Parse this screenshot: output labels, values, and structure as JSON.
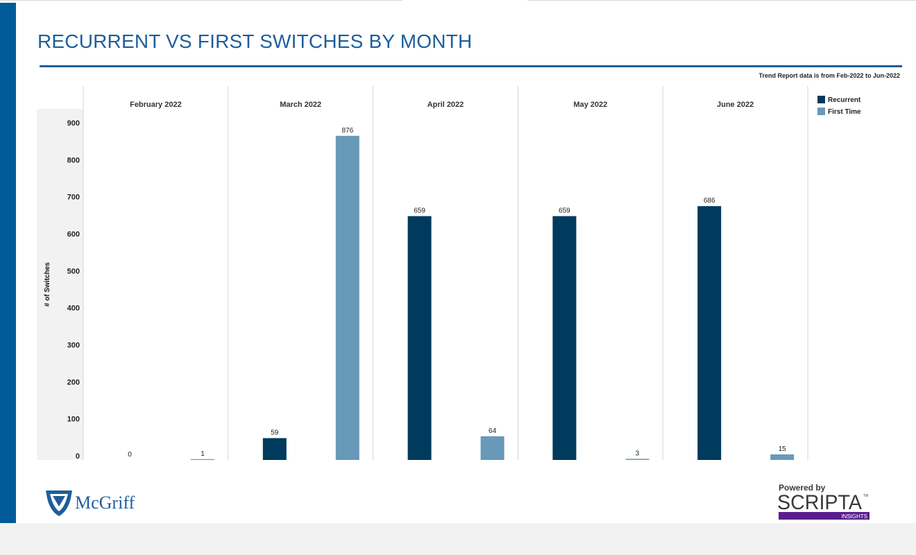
{
  "report": {
    "title": "RECURRENT VS FIRST SWITCHES BY MONTH",
    "note": "Trend Report data is from Feb-2022 to Jun-2022"
  },
  "colors": {
    "brand_blue": "#005b99",
    "title_blue": "#1d5e9c",
    "recurrent": "#003a5d",
    "first_time": "#6899b8"
  },
  "logos": {
    "left": {
      "name": "McGriff",
      "icon": "shield-logo-icon"
    },
    "right": {
      "powered_by": "Powered by",
      "name": "SCRIPTA",
      "sub": "INSIGHTS",
      "tm": "TM"
    }
  },
  "chart_data": {
    "type": "bar",
    "categories": [
      "February 2022",
      "March 2022",
      "April 2022",
      "May 2022",
      "June 2022"
    ],
    "series": [
      {
        "name": "Recurrent",
        "color": "#003a5d",
        "values": [
          0,
          59,
          659,
          659,
          686
        ]
      },
      {
        "name": "First Time",
        "color": "#6899b8",
        "values": [
          1,
          876,
          64,
          3,
          15
        ]
      }
    ],
    "ylabel": "# of Switches",
    "xlabel": "",
    "ylim": [
      0,
      900
    ],
    "yticks": [
      0,
      100,
      200,
      300,
      400,
      500,
      600,
      700,
      800,
      900
    ],
    "legend": "top-right",
    "grid": false,
    "data_labels": true
  }
}
